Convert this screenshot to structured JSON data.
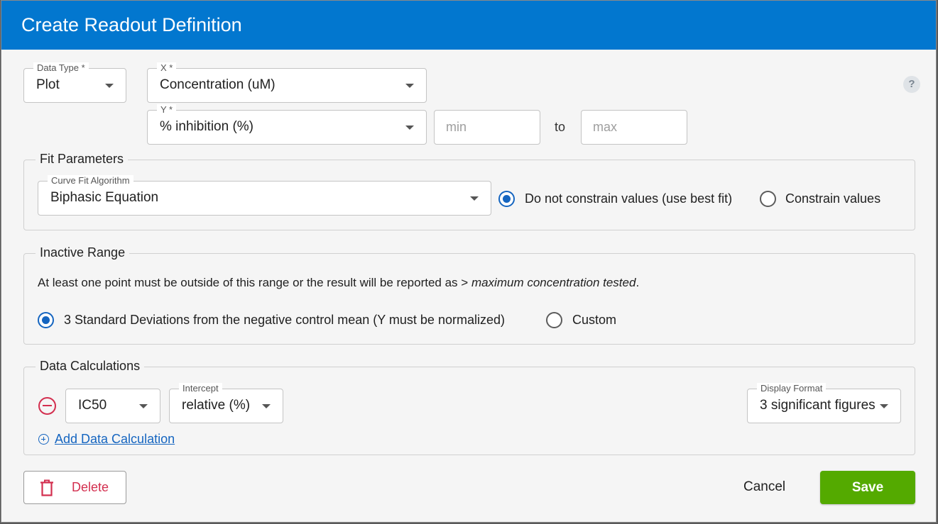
{
  "dialog": {
    "title": "Create Readout Definition"
  },
  "top": {
    "data_type": {
      "label": "Data Type *",
      "value": "Plot"
    },
    "x": {
      "label": "X *",
      "value": "Concentration (uM)"
    },
    "y": {
      "label": "Y *",
      "value": "% inhibition (%)"
    },
    "min_placeholder": "min",
    "to_label": "to",
    "max_placeholder": "max",
    "help_icon": "?"
  },
  "fit_parameters": {
    "legend": "Fit Parameters",
    "algorithm": {
      "label": "Curve Fit Algorithm",
      "value": "Biphasic Equation"
    },
    "options": [
      {
        "label": "Do not constrain values (use best fit)",
        "checked": true
      },
      {
        "label": "Constrain values",
        "checked": false
      }
    ]
  },
  "inactive_range": {
    "legend": "Inactive Range",
    "note_prefix": "At least one point must be outside of this range or the result will be reported as > ",
    "note_italic": "maximum concentration tested",
    "note_suffix": ".",
    "options": [
      {
        "label": "3 Standard Deviations from the negative control mean (Y must be normalized)",
        "checked": true
      },
      {
        "label": "Custom",
        "checked": false
      }
    ]
  },
  "data_calculations": {
    "legend": "Data Calculations",
    "calc": {
      "value": "IC50"
    },
    "intercept": {
      "label": "Intercept",
      "value": "relative (%)"
    },
    "display_format": {
      "label": "Display Format",
      "value": "3 significant figures"
    },
    "add_link": "Add Data Calculation"
  },
  "footer": {
    "delete_label": "Delete",
    "cancel_label": "Cancel",
    "save_label": "Save"
  },
  "colors": {
    "header": "#0277cf",
    "save": "#54aa00",
    "danger": "#d32f4f",
    "accent": "#1565c0"
  }
}
